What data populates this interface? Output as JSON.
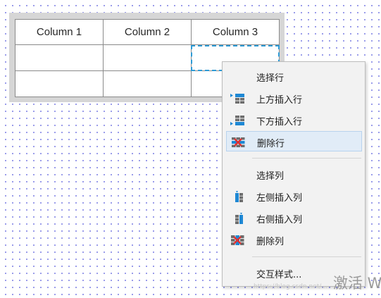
{
  "table": {
    "headers": [
      "Column 1",
      "Column 2",
      "Column 3"
    ],
    "rows": [
      [
        "",
        "",
        ""
      ],
      [
        "",
        "",
        ""
      ]
    ]
  },
  "context_menu": {
    "items": [
      {
        "label": "选择行",
        "icon": ""
      },
      {
        "label": "上方插入行",
        "icon": "insert-row-above-icon"
      },
      {
        "label": "下方插入行",
        "icon": "insert-row-below-icon"
      },
      {
        "label": "删除行",
        "icon": "delete-row-icon",
        "highlighted": true
      },
      {
        "label": "选择列",
        "icon": ""
      },
      {
        "label": "左侧插入列",
        "icon": "insert-column-left-icon"
      },
      {
        "label": "右侧插入列",
        "icon": "insert-column-right-icon"
      },
      {
        "label": "删除列",
        "icon": "delete-column-icon"
      },
      {
        "label": "交互样式...",
        "icon": ""
      }
    ]
  },
  "watermark": {
    "text": "激活 W",
    "sub": "https://blog.csdn.net/..."
  },
  "colors": {
    "selection": "#2e9bd6",
    "highlight": "#e1ecf7",
    "menu_bg": "#f2f2f2",
    "icon_blue": "#1e88d4",
    "icon_red": "#e03131"
  }
}
